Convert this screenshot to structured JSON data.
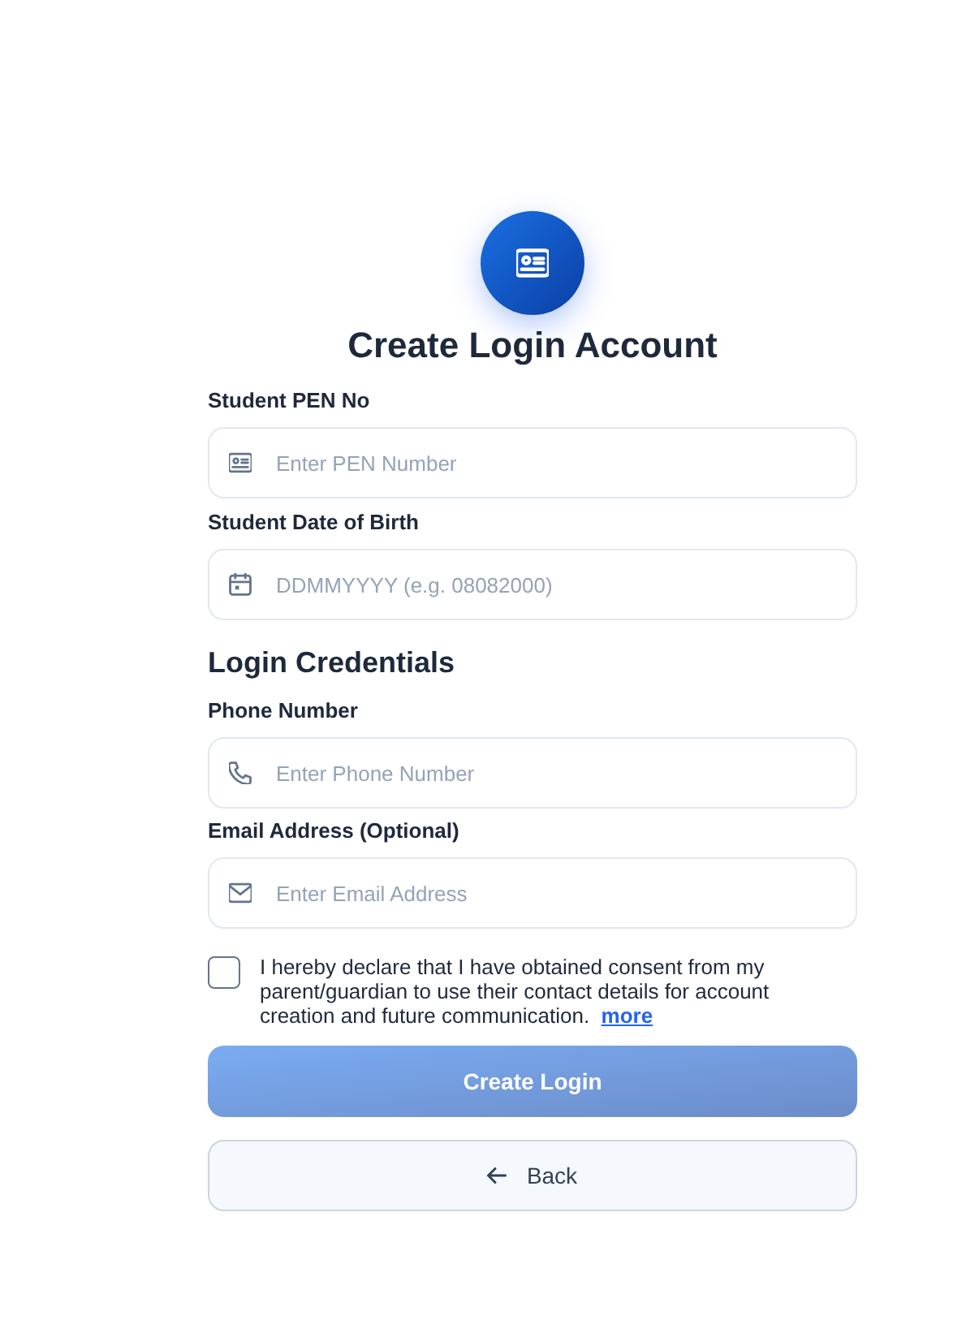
{
  "header": {
    "title": "Create Login Account"
  },
  "student_fields": [
    {
      "label": "Student PEN No",
      "placeholder": "Enter PEN Number",
      "kind": "id"
    },
    {
      "label": "Student Date of Birth",
      "placeholder": "DDMMYYYY (e.g. 08082000)",
      "kind": "date"
    }
  ],
  "credentials": {
    "title": "Login Credentials",
    "fields": [
      {
        "label": "Phone Number",
        "placeholder": "Enter Phone Number",
        "kind": "phone"
      },
      {
        "label": "Email Address (Optional)",
        "placeholder": "Enter Email Address",
        "kind": "email"
      }
    ]
  },
  "consent": {
    "checked": false,
    "text": "I hereby declare that I have obtained consent from my parent/guardian to use their contact details for account creation and future communication.",
    "link": "more"
  },
  "buttons": [
    {
      "label": "Create Login",
      "kind": "primary",
      "disabled": true
    },
    {
      "label": "Back",
      "kind": "back",
      "disabled": false
    }
  ]
}
